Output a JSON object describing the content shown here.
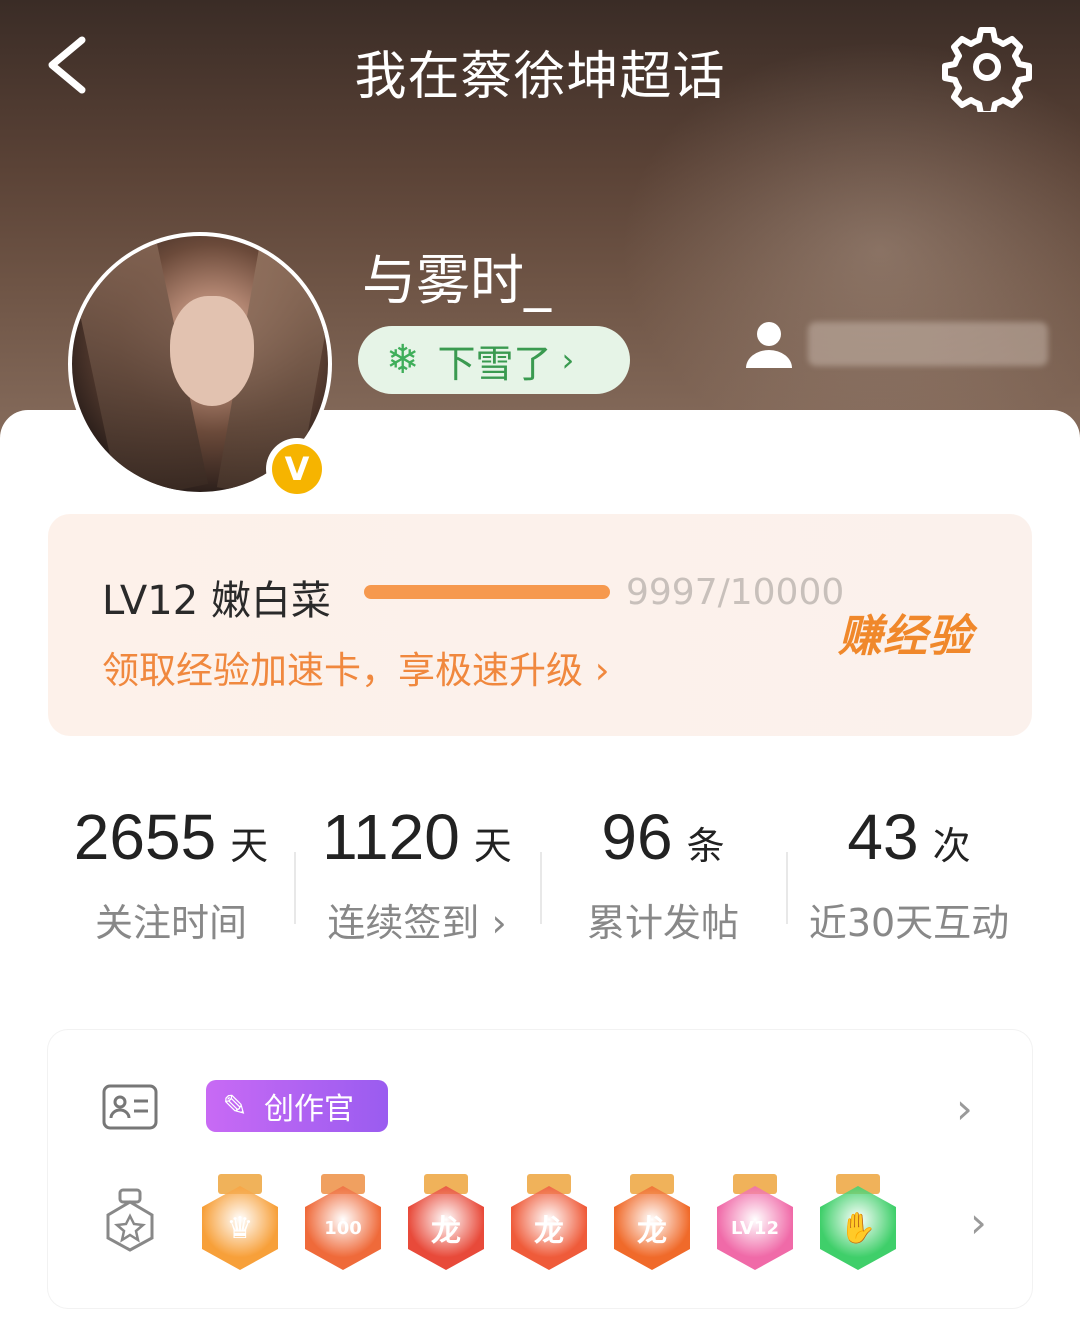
{
  "header": {
    "title": "我在蔡徐坤超话"
  },
  "profile": {
    "username": "与雾时_",
    "status": {
      "icon": "snowflake-icon",
      "label": "下雪了",
      "chevron": "›"
    },
    "verified_label": "V"
  },
  "level": {
    "label": "LV12 嫩白菜",
    "exp": "9997/10000",
    "progress_fraction": 0.9997,
    "promo": "领取经验加速卡，享极速升级 ›",
    "earn": "赚经验"
  },
  "stats": [
    {
      "num": "2655",
      "unit": "天",
      "label": "关注时间"
    },
    {
      "num": "1120",
      "unit": "天",
      "label": "连续签到 ›"
    },
    {
      "num": "96",
      "unit": "条",
      "label": "累计发帖"
    },
    {
      "num": "43",
      "unit": "次",
      "label": "近30天互动"
    }
  ],
  "badges": {
    "creator_label": "创作官",
    "arrow": "›",
    "medals": [
      {
        "name": "crown-medal",
        "color": "#f7a03a",
        "ribbon": "#f0b25a",
        "glyph": "♛"
      },
      {
        "name": "100-days-medal",
        "color": "#ef6a3a",
        "ribbon": "#f0a060",
        "glyph": "100"
      },
      {
        "name": "dragon-medal-1",
        "color": "#e84a3a",
        "ribbon": "#f0b25a",
        "glyph": "龙"
      },
      {
        "name": "dragon-medal-2",
        "color": "#ef5b3a",
        "ribbon": "#f0b25a",
        "glyph": "龙"
      },
      {
        "name": "dragon-medal-3",
        "color": "#f06a2a",
        "ribbon": "#f0b25a",
        "glyph": "龙"
      },
      {
        "name": "lv12-medal",
        "color": "#f06aa8",
        "ribbon": "#f0b25a",
        "glyph": "LV12"
      },
      {
        "name": "hand-medal",
        "color": "#3fcf6a",
        "ribbon": "#f0b25a",
        "glyph": "✋"
      }
    ]
  },
  "colors": {
    "accent_orange": "#f0883e",
    "status_green": "#3a9a50",
    "verified_gold": "#f6b400",
    "creator_purple": "#b064f2"
  }
}
